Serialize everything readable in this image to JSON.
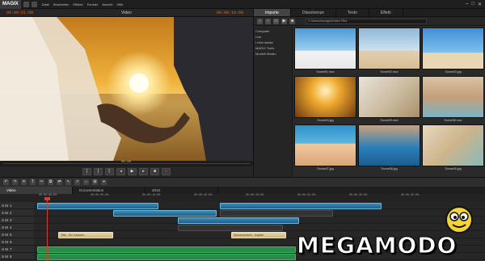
{
  "app": {
    "logo": "MAGIX",
    "menu": [
      "Datei",
      "Bearbeiten",
      "Effekte",
      "Fenster",
      "Ansicht",
      "Hilfe"
    ],
    "window_controls": [
      "–",
      "□",
      "✕"
    ]
  },
  "video_panel": {
    "title": "Video",
    "timecode_left": "00:00:01:00",
    "timecode_right": "00:00:10:09",
    "position_label": "00:00",
    "transport": [
      "[",
      "]",
      "⟦",
      "◂",
      "▶",
      "▸",
      "■",
      "●"
    ]
  },
  "media_panel": {
    "tabs": [
      "Importe",
      "Dissolvenze",
      "Testo",
      "Effetti"
    ],
    "active_tab": "Importe",
    "path": "C:\\Users\\Immagini\\Video Files",
    "sidebar": [
      "Computer",
      "Live",
      "I miei media",
      "MAGIX Tools",
      "Modelli filmato"
    ],
    "thumbnails": [
      {
        "caption": "Sonne01.mov",
        "theme": "boat"
      },
      {
        "caption": "Sonne02.mov",
        "theme": "beach-girl"
      },
      {
        "caption": "Sonne03.jpg",
        "theme": "sunglasses"
      },
      {
        "caption": "Sonne04.jpg",
        "theme": "sunset-couple"
      },
      {
        "caption": "Sonne05.mov",
        "theme": "sandcastle"
      },
      {
        "caption": "Sonne06.mov",
        "theme": "water-girl"
      },
      {
        "caption": "Sonne07.jpg",
        "theme": "kids-pool"
      },
      {
        "caption": "Sonne08.jpg",
        "theme": "kids-splash"
      },
      {
        "caption": "Sonne09.jpg",
        "theme": "sand"
      }
    ]
  },
  "timeline": {
    "tools": [
      "↶",
      "↷",
      "✕",
      "T",
      "✂",
      "⧉",
      "⇄",
      "↖",
      "↗",
      "⇔",
      "⊞",
      "⌖"
    ],
    "tabs": [
      "Video",
      "Documentation",
      "2015"
    ],
    "active_tab": "Video",
    "ruler_marks": [
      "00:00:00:00",
      "00:00:05:00",
      "00:00:10:00",
      "00:00:15:00",
      "00:00:20:00",
      "00:00:25:00",
      "00:00:30:00",
      "00:00:35:00"
    ],
    "tracks": [
      {
        "num": "1",
        "flags": "S M"
      },
      {
        "num": "2",
        "flags": "S M"
      },
      {
        "num": "3",
        "flags": "S M"
      },
      {
        "num": "4",
        "flags": "S M"
      },
      {
        "num": "5",
        "flags": "S M"
      },
      {
        "num": "6",
        "flags": "S M"
      },
      {
        "num": "7",
        "flags": "S M"
      },
      {
        "num": "8",
        "flags": "S M"
      }
    ],
    "title_clips": [
      "Title - Ein Zaubern",
      "Sonnenschein - Kapitel"
    ]
  },
  "watermark": {
    "text": "MEGAMODO"
  },
  "colors": {
    "accent_timecode": "#e0672f",
    "playhead": "#e03a2a",
    "video_clip": "#3a8cb8",
    "title_clip": "#e8d8a6",
    "audio_clip": "#2a8a4a"
  }
}
